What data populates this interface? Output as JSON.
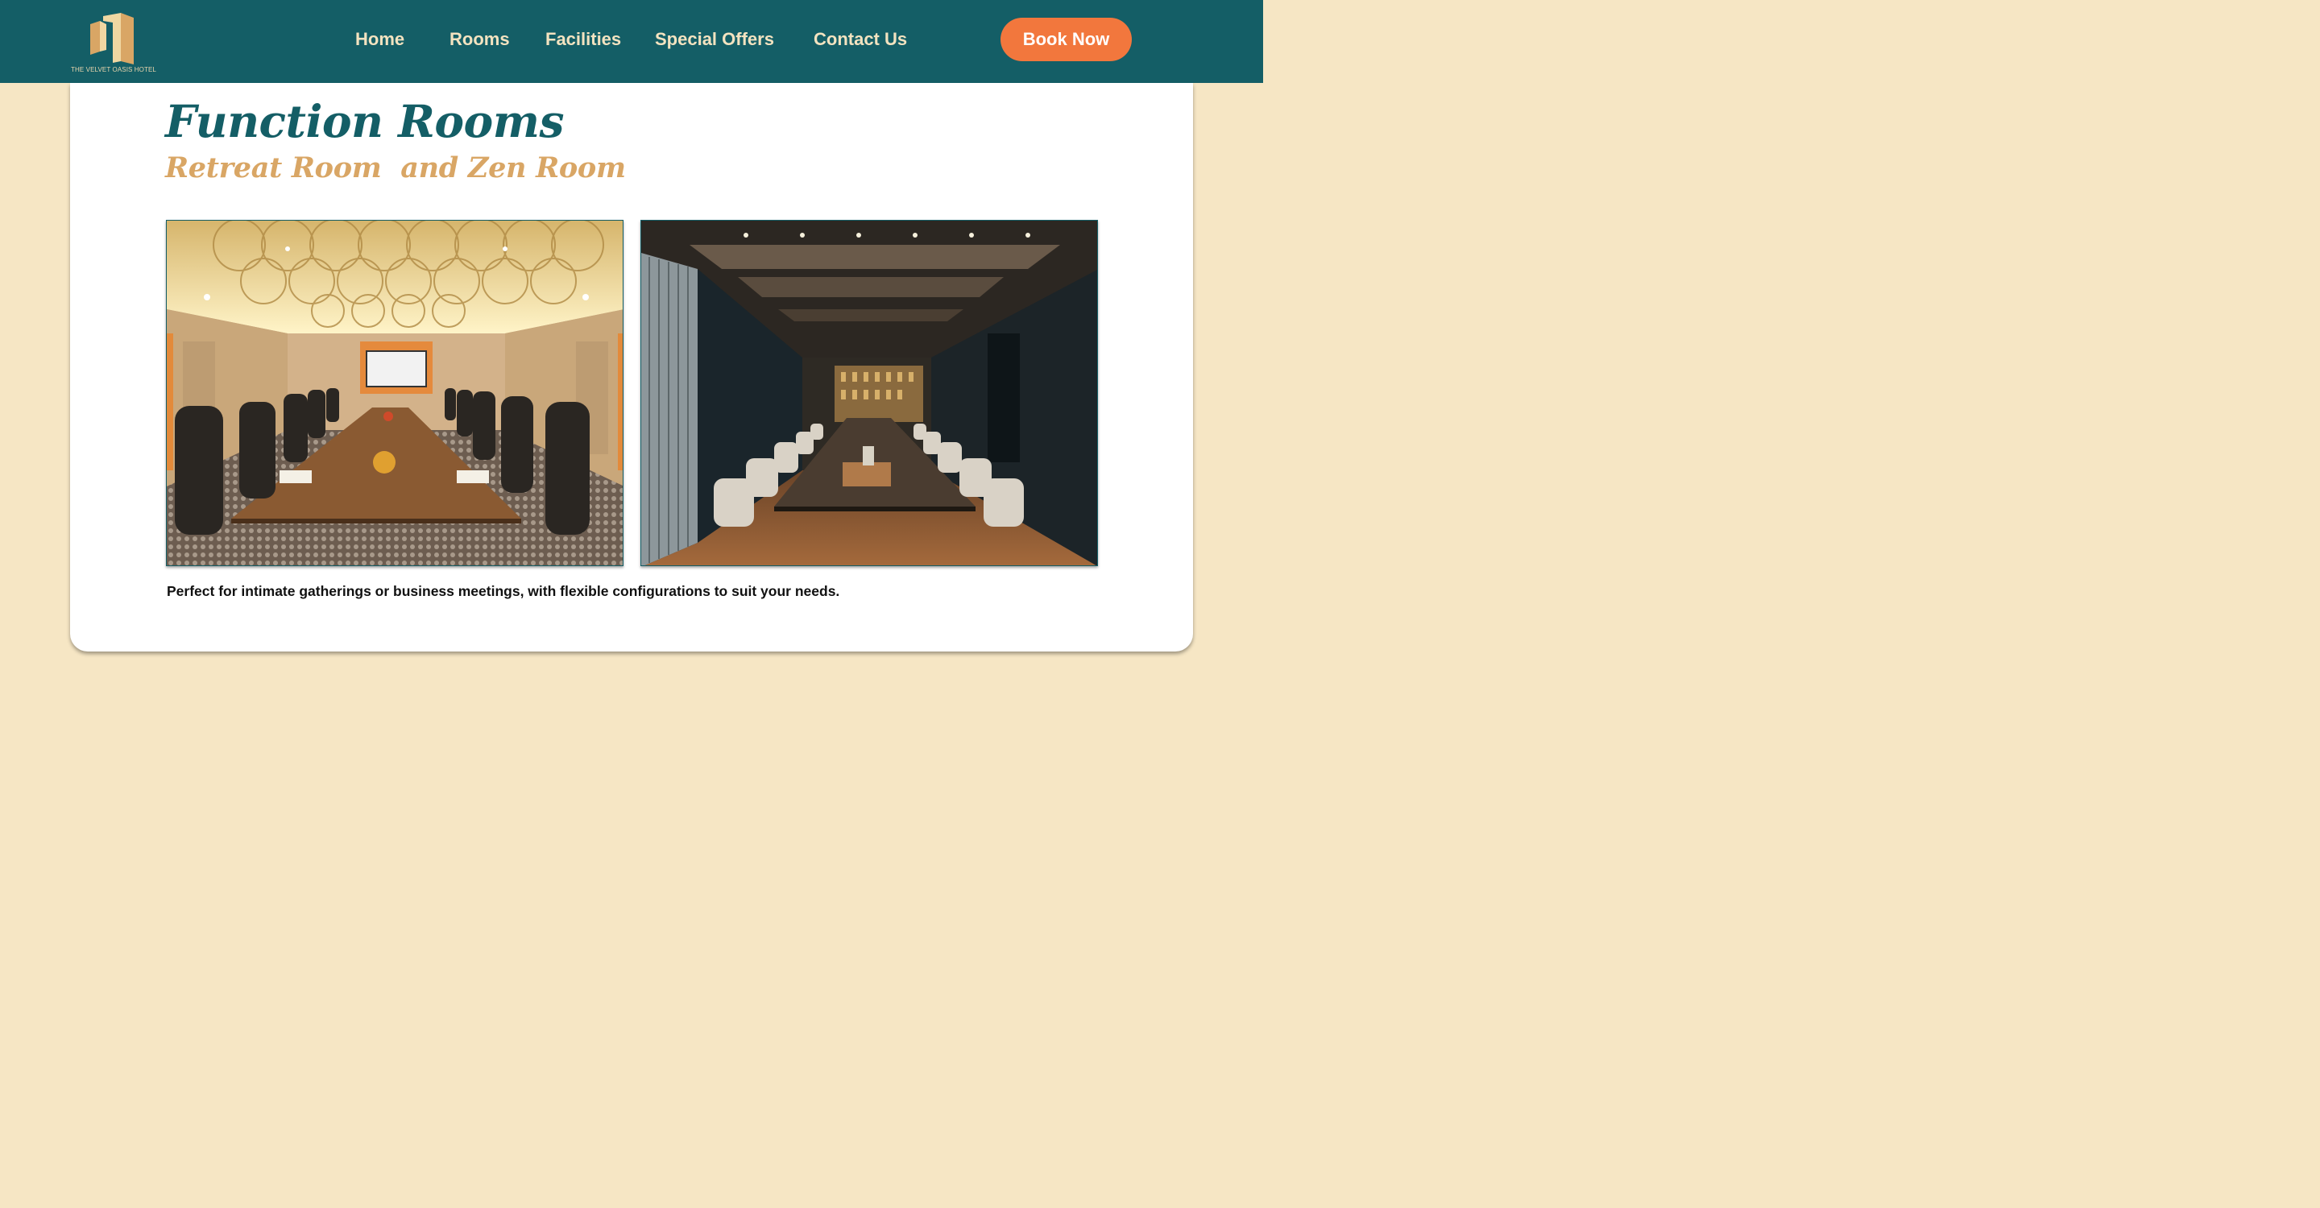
{
  "brand": {
    "name": "THE VELVET OASIS HOTEL",
    "logo_icon": "building-logo-icon"
  },
  "nav": {
    "items": [
      {
        "label": "Home"
      },
      {
        "label": "Rooms"
      },
      {
        "label": "Facilities"
      },
      {
        "label": "Special Offers"
      },
      {
        "label": "Contact Us"
      }
    ],
    "cta_label": "Book Now"
  },
  "section": {
    "title": "Function Rooms",
    "subtitle": "Retreat Room  and Zen Room",
    "description": "Perfect for intimate gatherings or business meetings, with flexible configurations to suit your needs."
  },
  "photos": [
    {
      "room": "retreat-room",
      "icon": "retreat-room-photo"
    },
    {
      "room": "zen-room",
      "icon": "zen-room-photo"
    }
  ],
  "colors": {
    "header_bg": "#145e66",
    "page_bg": "#f6e6c4",
    "accent_orange": "#f2773d",
    "gold": "#d9a665",
    "teal_text": "#145e66"
  }
}
